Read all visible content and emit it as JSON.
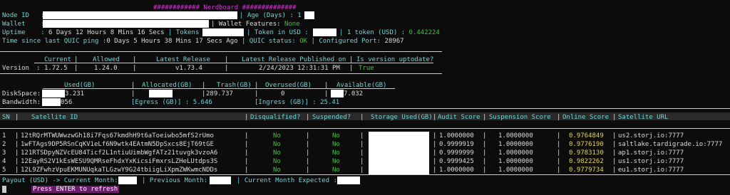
{
  "title": "############ Nerdboard ##############",
  "header": {
    "node_id_label": "Node ID   :",
    "age_label": "| Age (Days) : 1",
    "wallet_label": "Wallet    :",
    "wallet_features_label": "| Wallet Features: ",
    "wallet_features_value": "None",
    "uptime_label": "Uptime    :",
    "uptime_value": "6 Days 12 Hours 8 Mins 16 Secs",
    "tokens_label": "| Tokens :",
    "token_usd_label": "| Token in USD :",
    "one_token_label": "| 1 token (USD) :",
    "one_token_value": "0.442224",
    "quic_ping_label": "Time since last QUIC ping :",
    "quic_ping_value": "0 Days 5 Hours 38 Mins 17 Secs Ago",
    "quic_status_label": "| QUIC status: ",
    "quic_status_value": "OK",
    "port_label": "| Configured Port: ",
    "port_value": "28967"
  },
  "version": {
    "headers": [
      "Current",
      "Allowed",
      "Latest Release",
      "Latest Release Published on",
      "Is version uptodate?"
    ],
    "row_label": "Version",
    "current": "1.72.5",
    "allowed": "1.24.0",
    "latest": "v1.73.4",
    "published": "2/24/2023 12:31:31 PM",
    "uptodate": "True"
  },
  "disk": {
    "headers": [
      "Used(GB)",
      "Allocated(GB)",
      "Trash(GB)",
      "Overused(GB)",
      "Available(GB)"
    ],
    "diskspace_label": "DiskSpace:",
    "used_suffix": "3.231",
    "trash": "289.737",
    "overused": "0",
    "available_suffix": "7.032",
    "bandwidth_label": "Bandwidth:",
    "bandwidth_suffix": "056",
    "egress_label": "[Egress (GB)] : 5.646",
    "ingress_label": "[Ingress (GB)] : 25.41"
  },
  "satellites": {
    "headers": [
      "SN",
      "Satellite ID",
      "Disqualified?",
      "Suspended?",
      "Storage Used(GB)",
      "Audit Score",
      "Suspension Score",
      "Online Score",
      "Satellite URL"
    ],
    "rows": [
      {
        "sn": "1",
        "id": "12tRQrMTWUWwzwGh18i7Fqs67kmdhH9t6aToeiwbo5mfS2rUmo",
        "disq": "No",
        "susp": "No",
        "audit": "1.0000000",
        "suspension": "1.0000000",
        "online": "0.9764849",
        "url": "us2.storj.io:7777"
      },
      {
        "sn": "2",
        "id": "1wFTAgs9DP5RSnCqKV1eLf6N9wtk4EAtmN5DpSxcs8EjT69tGE",
        "disq": "No",
        "susp": "No",
        "audit": "0.9999919",
        "suspension": "1.0000000",
        "online": "0.9776190",
        "url": "saltlake.tardigrade.io:7777"
      },
      {
        "sn": "3",
        "id": "121RTSDpyNZVcEU84Ticf2L1ntiuUimbWgfATz21tuvgk3vzoA6",
        "disq": "No",
        "susp": "No",
        "audit": "0.9999999",
        "suspension": "1.0000000",
        "online": "0.9783130",
        "url": "ap1.storj.io:7777"
      },
      {
        "sn": "4",
        "id": "12EayRS2V1kEsWESU9QMRseFhdxYxKicsiFmxrsLZHeLUtdps3S",
        "disq": "No",
        "susp": "No",
        "audit": "0.9999425",
        "suspension": "1.0000000",
        "online": "0.9822262",
        "url": "us1.storj.io:7777"
      },
      {
        "sn": "5",
        "id": "12L9ZFwhzVpuEKMUNUqkaTLGzwY9G24tbiigLiXpmZWKwmcNDDs",
        "disq": "No",
        "susp": "No",
        "audit": "1.0000000",
        "suspension": "1.0000000",
        "online": "0.9779734",
        "url": "eu1.storj.io:7777"
      }
    ]
  },
  "payout": {
    "label": "Payout (USD) -> Current Month:",
    "previous_label": "| Previous Month:",
    "expected_label": "| Current Month Expected :"
  },
  "prompt": "Press ENTER to refresh"
}
